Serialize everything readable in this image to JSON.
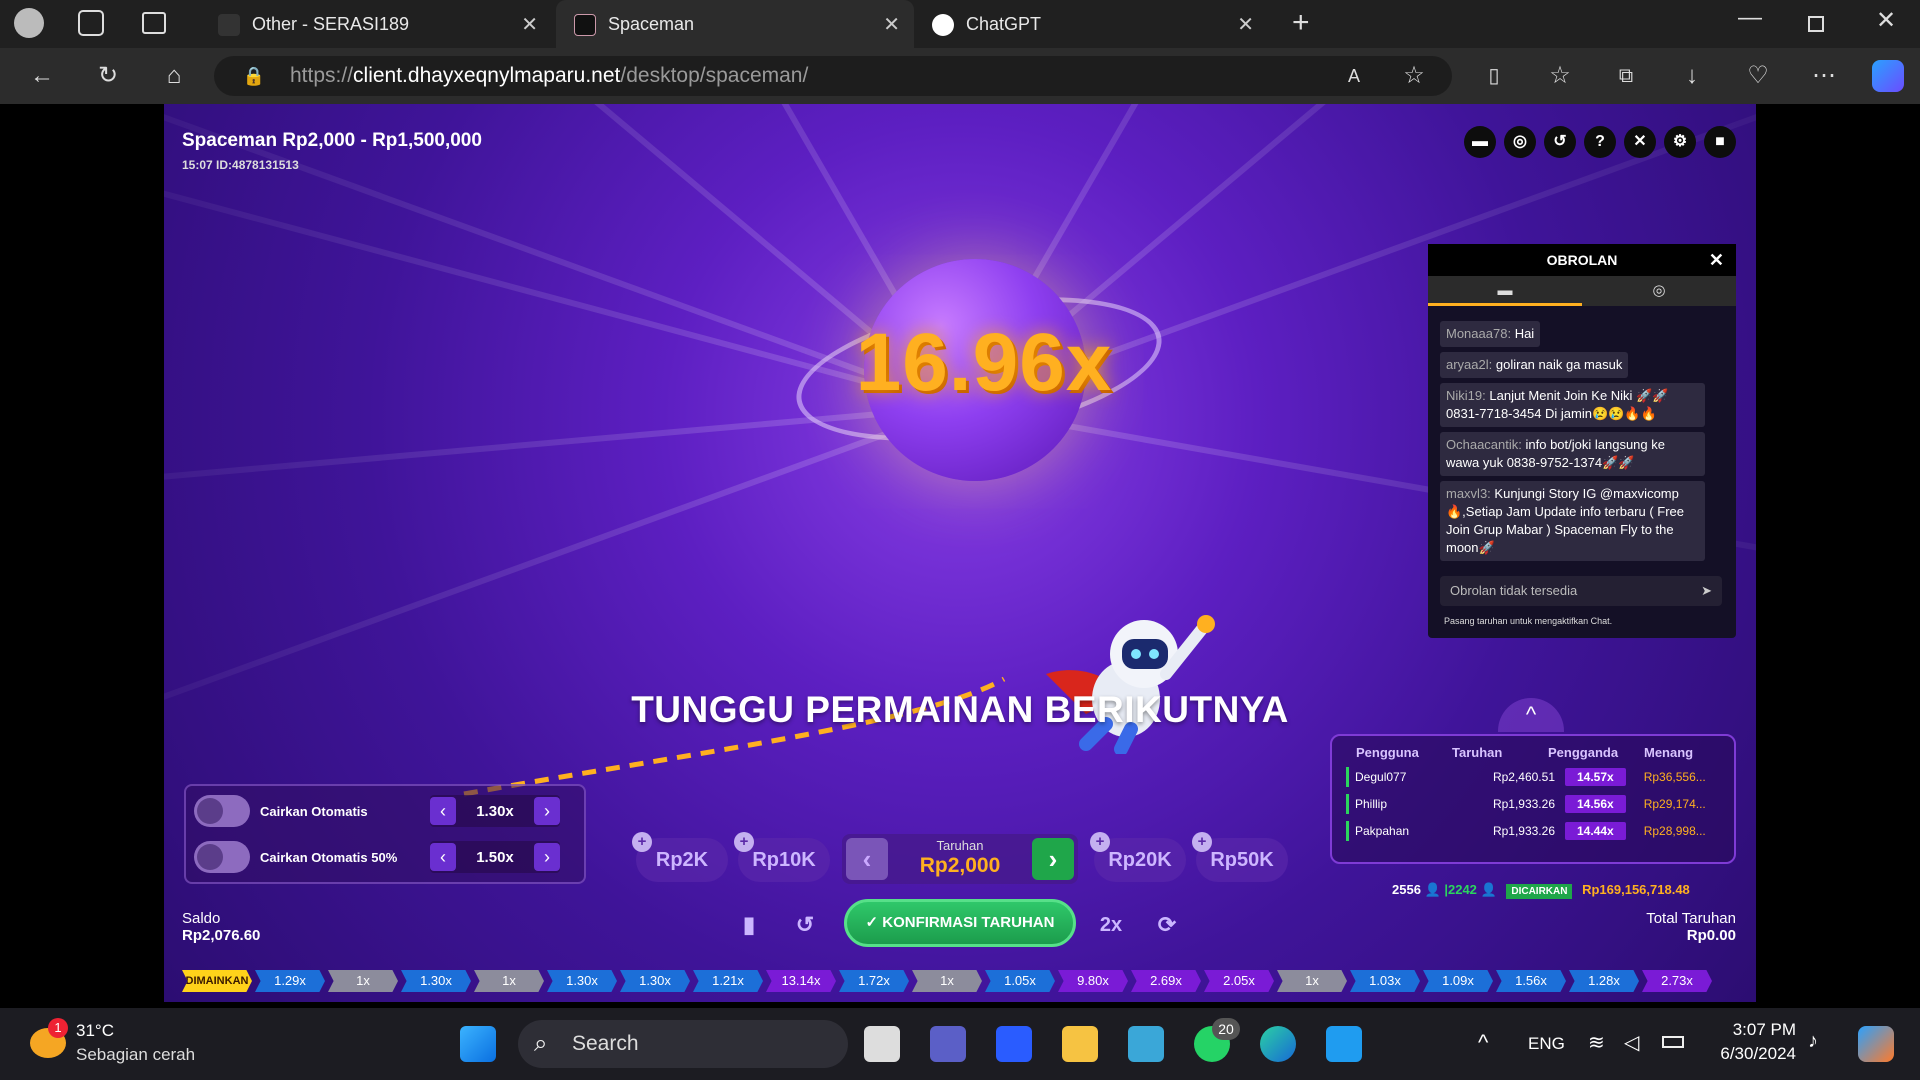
{
  "browser": {
    "tabs": [
      {
        "title": "Other - SERASI189"
      },
      {
        "title": "Spaceman"
      },
      {
        "title": "ChatGPT"
      }
    ],
    "url_prefix": "https://",
    "url_domain": "client.dhayxeqnylmaparu.net",
    "url_path": "/desktop/spaceman/"
  },
  "game": {
    "title": "Spaceman Rp2,000 - Rp1,500,000",
    "round_id": "15:07 ID:4878131513",
    "multiplier": "16.96x",
    "status_text": "TUNGGU PERMAINAN BERIKUTNYA",
    "colors": {
      "accent": "#ffb020",
      "green": "#2bd55e",
      "bg": "#3f1499"
    }
  },
  "chat": {
    "title": "OBROLAN",
    "messages": [
      {
        "user": "Monaaa78:",
        "text": "Hai"
      },
      {
        "user": "aryaa2l:",
        "text": "goliran naik ga masuk"
      },
      {
        "user": "Niki19:",
        "text": "Lanjut Menit Join Ke Niki 🚀🚀 0831-7718-3454 Di jamin😢😢🔥🔥"
      },
      {
        "user": "Ochaacantik:",
        "text": "info bot/joki langsung ke wawa yuk 0838-9752-1374🚀🚀"
      },
      {
        "user": "maxvl3:",
        "text": "Kunjungi Story IG @maxvicomp🔥,Setiap Jam Update info terbaru ( Free Join Grup Mabar ) Spaceman Fly to the moon🚀"
      }
    ],
    "input_placeholder": "Obrolan tidak tersedia",
    "note": "Pasang taruhan untuk mengaktifkan Chat."
  },
  "bets_table": {
    "headers": [
      "Pengguna",
      "Taruhan",
      "Pengganda",
      "Menang"
    ],
    "rows": [
      {
        "user": "Degul077",
        "bet": "Rp2,460.51",
        "mult": "14.57x",
        "win": "Rp36,556..."
      },
      {
        "user": "Phillip",
        "bet": "Rp1,933.26",
        "mult": "14.56x",
        "win": "Rp29,174..."
      },
      {
        "user": "Pakpahan",
        "bet": "Rp1,933.26",
        "mult": "14.44x",
        "win": "Rp28,998..."
      }
    ],
    "players": "2556",
    "cashed_count": "|2242",
    "cashed_label": "DICAIRKAN",
    "cashed_total": "Rp169,156,718.48"
  },
  "auto": {
    "row1_label": "Cairkan Otomatis",
    "row1_value": "1.30x",
    "row2_label": "Cairkan Otomatis 50%",
    "row2_value": "1.50x"
  },
  "bet_controls": {
    "chips": [
      "Rp2K",
      "Rp10K",
      "Rp20K",
      "Rp50K"
    ],
    "bet_label": "Taruhan",
    "bet_value": "Rp2,000",
    "confirm_label": "KONFIRMASI TARUHAN",
    "double_label": "2x"
  },
  "balance": {
    "label": "Saldo",
    "value": "Rp2,076.60"
  },
  "total_bet": {
    "label": "Total Taruhan",
    "value": "Rp0.00"
  },
  "history": [
    "DIMAINKAN",
    "1.29x",
    "1x",
    "1.30x",
    "1x",
    "1.30x",
    "1.30x",
    "1.21x",
    "13.14x",
    "1.72x",
    "1x",
    "1.05x",
    "9.80x",
    "2.69x",
    "2.05x",
    "1x",
    "1.03x",
    "1.09x",
    "1.56x",
    "1.28x",
    "2.73x"
  ],
  "taskbar": {
    "weather_temp": "31°C",
    "weather_desc": "Sebagian cerah",
    "weather_badge": "1",
    "search_placeholder": "Search",
    "whatsapp_badge": "20",
    "lang": "ENG",
    "time": "3:07 PM",
    "date": "6/30/2024"
  }
}
